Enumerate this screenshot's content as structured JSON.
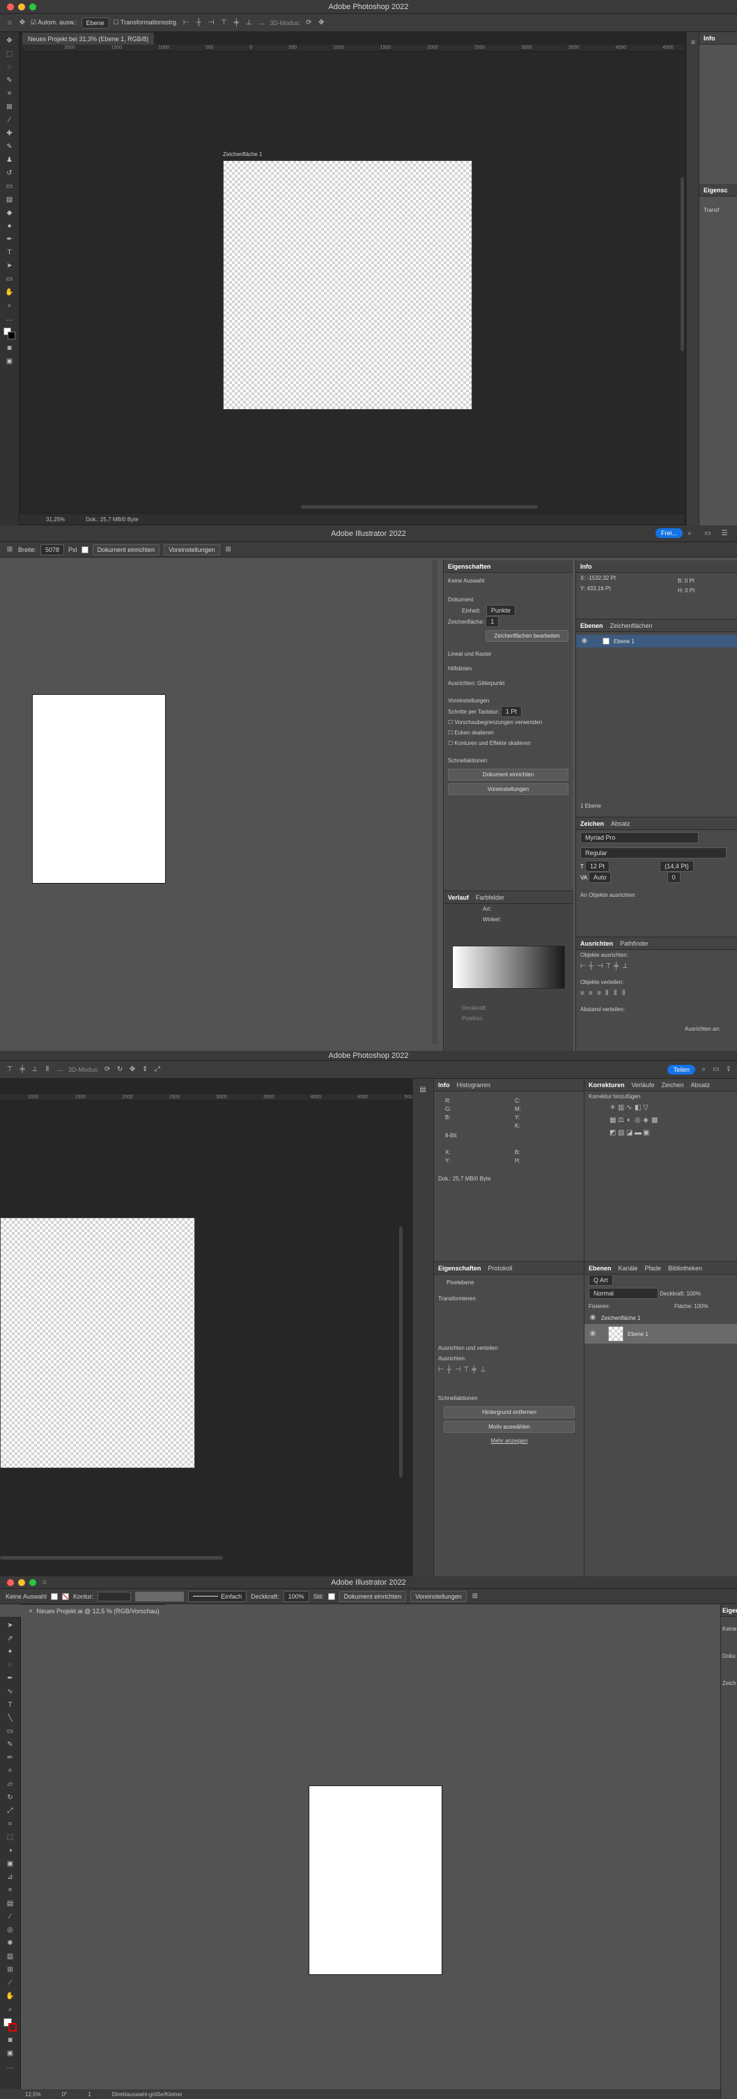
{
  "shot1": {
    "app_title": "Adobe Photoshop 2022",
    "options": {
      "auto_select": "Autom. ausw.:",
      "layer_dropdown": "Ebene",
      "transform": "Transformationsstrg.",
      "mode_3d": "3D-Modus:"
    },
    "doc_tab": "Neues Projekt bei 31,3% (Ebene 1, RGB/8)",
    "ruler_ticks": [
      "2000",
      "1500",
      "1000",
      "500",
      "0",
      "500",
      "1000",
      "1500",
      "2000",
      "2500",
      "3000",
      "3500",
      "4000",
      "4500",
      "5000"
    ],
    "artboard_label": "Zeichenfläche 1",
    "status_zoom": "31,25%",
    "status_doc": "Dok.: 25,7 MB/0 Byte",
    "right_panel": {
      "info_tab": "Info",
      "props_tab": "Eigensc",
      "item": "Transf"
    }
  },
  "shot2": {
    "app_title": "Adobe Illustrator 2022",
    "share_label": "Frei...",
    "options": {
      "stroke_label": "Breite:",
      "stroke_value": "5078",
      "unit": "Pxl",
      "doc_setup": "Dokument einrichten",
      "prefs": "Voreinstellungen"
    },
    "properties": {
      "tab": "Eigenschaften",
      "no_selection": "Keine Auswahl",
      "document": "Dokument",
      "units_label": "Einheit:",
      "units_value": "Punkte",
      "artboard_label": "Zeichenfläche:",
      "artboard_value": "1",
      "edit_artboard": "Zeichenflächen bearbeiten",
      "grid_label": "Lineal und Raster",
      "guides_label": "Hilfslinien",
      "align_label": "Ausrichten: Gitterpunkt",
      "prefs_section": "Voreinstellungen",
      "key_increment": "Schritte per Tastatur:",
      "key_value": "1 Pt",
      "check1": "Vorschaubegrenzungen verwenden",
      "check2": "Ecken skalieren",
      "check3": "Konturen und Effekte skalieren",
      "quick_actions": "Schnellaktionen",
      "btn_doc_setup": "Dokument einrichten",
      "btn_prefs": "Voreinstellungen"
    },
    "gradient_panel": {
      "tab1": "Verlauf",
      "tab2": "Farbfelder",
      "type_label": "Art:",
      "angle_label": "Winkel:",
      "opacity_label": "Deckkraft:",
      "location_label": "Position:"
    },
    "info_panel": {
      "tab": "Info",
      "x": "X: -1532,32 Pt",
      "y": "Y: 433,16 Pt",
      "w": "B: 0 Pt",
      "h": "H: 0 Pt"
    },
    "layers_panel": {
      "tab1": "Ebenen",
      "tab2": "Zeichenflächen",
      "layer_name": "Ebene 1",
      "count": "1 Ebene"
    },
    "char_panel": {
      "tab1": "Zeichen",
      "tab2": "Absatz",
      "font": "Myriad Pro",
      "style": "Regular",
      "size": "12 Pt",
      "leading": "(14,4 Pt)",
      "tracking": "Auto",
      "kerning": "0",
      "align_objects": "An Objekte ausrichten"
    },
    "align_panel": {
      "tab1": "Ausrichten",
      "tab2": "Pathfinder",
      "align_objects": "Objekte ausrichten:",
      "distribute": "Objekte verteilen:",
      "distribute_spacing": "Abstand verteilen:",
      "align_to": "Ausrichten an:"
    }
  },
  "shot3": {
    "app_title": "Adobe Photoshop 2022",
    "share_label": "Teilen",
    "options": {
      "mode_3d": "3D-Modus:"
    },
    "ruler_ticks": [
      "1000",
      "1500",
      "2000",
      "2500",
      "3000",
      "3500",
      "4000",
      "4500",
      "5000"
    ],
    "info_panel": {
      "tab1": "Info",
      "tab2": "Histogramm",
      "r": "R:",
      "g": "G:",
      "b": "B:",
      "c": "C:",
      "m": "M:",
      "y": "Y:",
      "k": "K:",
      "bit": "8-Bit",
      "x": "X:",
      "yy": "Y:",
      "w": "B:",
      "h": "H:",
      "doc": "Dok.: 25,7 MB/0 Byte"
    },
    "adjustments_panel": {
      "tab1": "Korrekturen",
      "tab2": "Verläufe",
      "tab3": "Zeichen",
      "tab4": "Absatz",
      "add_label": "Korrektur hinzufügen"
    },
    "properties": {
      "tab1": "Eigenschaften",
      "tab2": "Protokoll",
      "pixel_layer": "Pixelebene",
      "transform": "Transformieren",
      "align": "Ausrichten und verteilen",
      "align_sub": "Ausrichten:",
      "quick_actions": "Schnellaktionen",
      "btn_remove_bg": "Hintergrund entfernen",
      "btn_select": "Motiv auswählen",
      "more": "Mehr anzeigen"
    },
    "layers_panel": {
      "tab1": "Ebenen",
      "tab2": "Kanäle",
      "tab3": "Pfade",
      "tab4": "Bibliotheken",
      "filter": "Q Art",
      "blend": "Normal",
      "opacity_label": "Deckkraft:",
      "opacity_value": "100%",
      "lock_label": "Fixieren:",
      "fill_label": "Fläche:",
      "fill_value": "100%",
      "artboard": "Zeichenfläche 1",
      "layer": "Ebene 1"
    }
  },
  "shot4": {
    "app_title": "Adobe Illustrator 2022",
    "options": {
      "no_selection": "Keine Auswahl",
      "stroke_label": "Kontur:",
      "basic": "Einfach",
      "opacity_label": "Deckkraft:",
      "opacity_value": "100%",
      "style_label": "Stil:",
      "doc_setup": "Dokument einrichten",
      "prefs": "Voreinstellungen"
    },
    "doc_tab": "Neues Projekt.ai @ 12,5 % (RGB/Vorschau)",
    "status_zoom": "12,5%",
    "status_angle": "0°",
    "status_artboard": "1",
    "status_tool": "Direktauswahl-größe/Kleiner",
    "right_panel": {
      "tab": "Eigens",
      "item1": "Keine",
      "item2": "Doku",
      "item3": "Zeich"
    }
  }
}
